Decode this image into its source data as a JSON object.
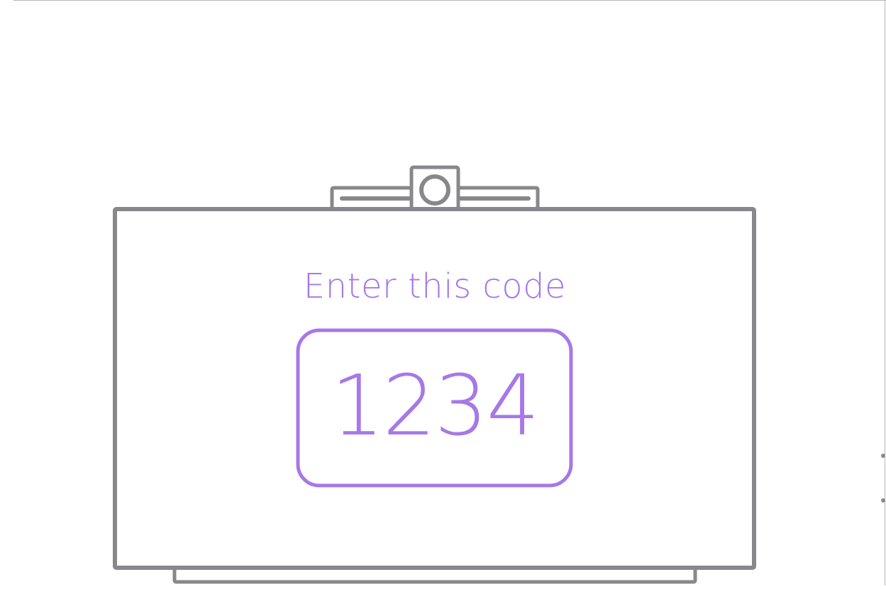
{
  "illustration": {
    "prompt": "Enter this code",
    "code": "1234"
  },
  "icons": {
    "tv": "tv-display-icon",
    "camera": "camera-bar-icon"
  },
  "colors": {
    "accent": "#A678E8",
    "outline": "#88888C",
    "border": "#B7B7B7",
    "background": "#FFFFFF"
  }
}
